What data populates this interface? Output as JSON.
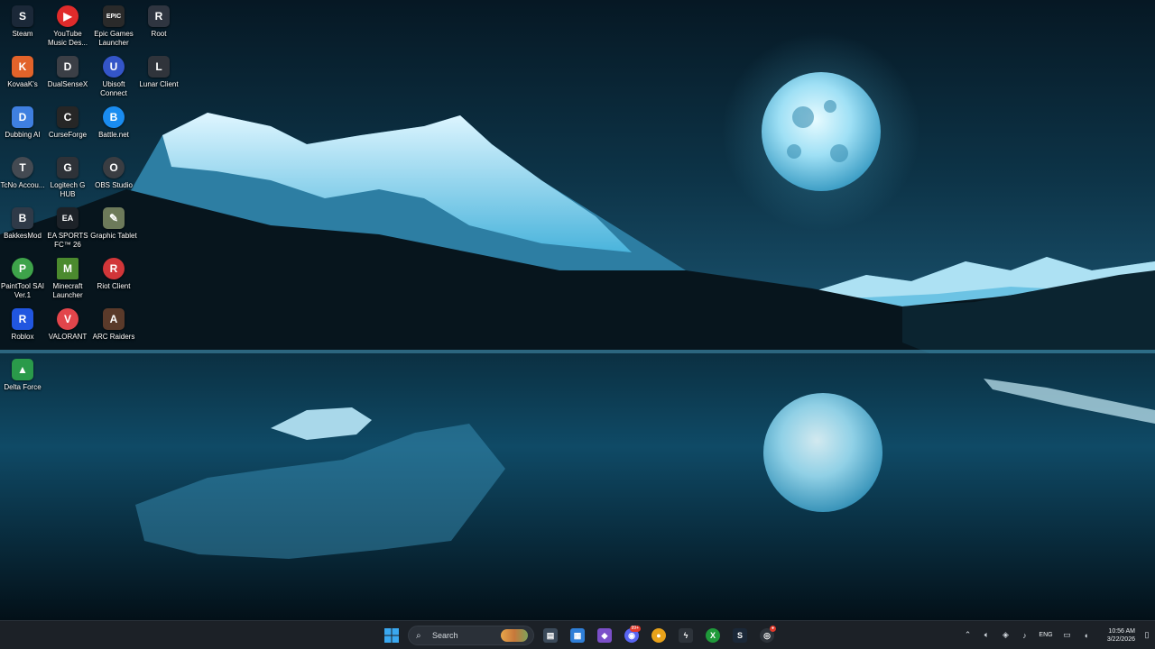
{
  "desktop": {
    "icons": [
      {
        "label": "Steam",
        "glyph": "S",
        "color": "#1b2838"
      },
      {
        "label": "YouTube Music Des...",
        "glyph": "▶",
        "color": "#e02b2b"
      },
      {
        "label": "Epic Games Launcher",
        "glyph": "EPIC",
        "color": "#2a2a2a"
      },
      {
        "label": "Root",
        "glyph": "R",
        "color": "#2f3540"
      },
      {
        "label": "KovaaK's",
        "glyph": "K",
        "color": "#e2632a"
      },
      {
        "label": "DualSenseX",
        "glyph": "D",
        "color": "#3b3f46"
      },
      {
        "label": "Ubisoft Connect",
        "glyph": "U",
        "color": "#3455c8"
      },
      {
        "label": "Lunar Client",
        "glyph": "L",
        "color": "#30343b"
      },
      {
        "label": "Dubbing AI",
        "glyph": "D",
        "color": "#3f7fe0"
      },
      {
        "label": "CurseForge",
        "glyph": "C",
        "color": "#262626"
      },
      {
        "label": "Battle.net",
        "glyph": "B",
        "color": "#1a8cf0"
      },
      {
        "label": "TcNo Accou...",
        "glyph": "T",
        "color": "#444a52"
      },
      {
        "label": "Logitech G HUB",
        "glyph": "G",
        "color": "#2e3238"
      },
      {
        "label": "OBS Studio",
        "glyph": "O",
        "color": "#3a3d42"
      },
      {
        "label": "BakkesMod",
        "glyph": "B",
        "color": "#2f3a48"
      },
      {
        "label": "EA SPORTS FC™ 26",
        "glyph": "EA",
        "color": "#1d2228"
      },
      {
        "label": "Graphic Tablet",
        "glyph": "✎",
        "color": "#6d7a5a"
      },
      {
        "label": "PaintTool SAI Ver.1",
        "glyph": "P",
        "color": "#3ea34a"
      },
      {
        "label": "Minecraft Launcher",
        "glyph": "M",
        "color": "#4b8a2e"
      },
      {
        "label": "Riot Client",
        "glyph": "R",
        "color": "#d13639"
      },
      {
        "label": "Roblox",
        "glyph": "R",
        "color": "#2156e0"
      },
      {
        "label": "VALORANT",
        "glyph": "V",
        "color": "#e2454b"
      },
      {
        "label": "ARC Raiders",
        "glyph": "A",
        "color": "#5a3a2a"
      },
      {
        "label": "Delta Force",
        "glyph": "▲",
        "color": "#2a9a4a"
      }
    ]
  },
  "taskbar": {
    "search_label": "Search",
    "apps": [
      {
        "name": "file-explorer-icon",
        "glyph": "▤",
        "color": "#3b4a5a"
      },
      {
        "name": "calendar-app-icon",
        "glyph": "▦",
        "color": "#2f7fd8"
      },
      {
        "name": "visual-studio-icon",
        "glyph": "◆",
        "color": "#7b4fc9"
      },
      {
        "name": "discord-icon",
        "glyph": "◉",
        "color": "#5865f2",
        "badge": "99+"
      },
      {
        "name": "game-app-icon",
        "glyph": "●",
        "color": "#e8a21a"
      },
      {
        "name": "lightning-app-icon",
        "glyph": "ϟ",
        "color": "#2d333a"
      },
      {
        "name": "xbox-icon",
        "glyph": "X",
        "color": "#1f9a3a"
      },
      {
        "name": "steam-taskbar-icon",
        "glyph": "S",
        "color": "#1b2838"
      },
      {
        "name": "chrome-icon",
        "glyph": "◎",
        "color": "#2d333a",
        "badge": "●"
      }
    ],
    "tray": {
      "language": "ENG",
      "time": "10:56 AM",
      "date": "3/22/2026"
    }
  }
}
